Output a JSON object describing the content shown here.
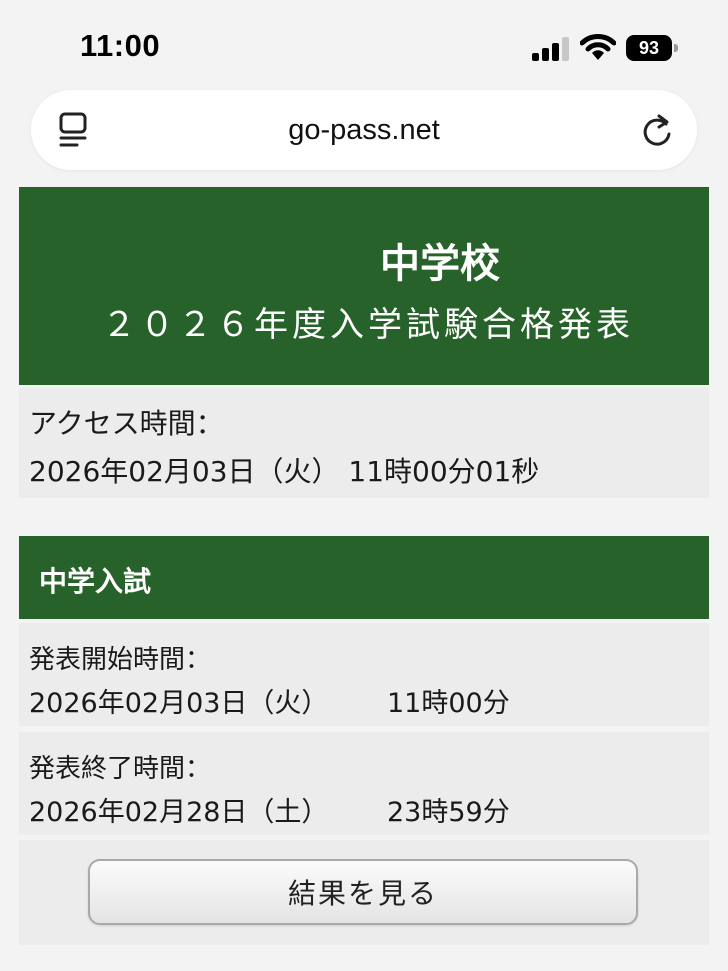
{
  "status_bar": {
    "time": "11:00",
    "battery": "93",
    "icons": [
      "signal-icon",
      "wifi-icon",
      "battery-icon"
    ]
  },
  "browser": {
    "url": "go-pass.net",
    "icons": [
      "page-menu-icon",
      "reload-icon"
    ]
  },
  "banner": {
    "school_name": "中学校",
    "title": "２０２６年度入学試験合格発表",
    "background": "#27622b"
  },
  "access": {
    "label": "アクセス時間：",
    "value": "2026年02月03日（火） 11時00分01秒"
  },
  "section": {
    "title": "中学入試"
  },
  "announcement": {
    "start_label": "発表開始時間：",
    "start_date": "2026年02月03日（火）",
    "start_time": "11時00分",
    "end_label": "発表終了時間：",
    "end_date": "2026年02月28日（土）",
    "end_time": "23時59分"
  },
  "button": {
    "label": "結果を見る"
  },
  "colors": {
    "accent_green": "#27622b",
    "panel_gray": "#ececec",
    "page_bg": "#f3f3f4"
  }
}
